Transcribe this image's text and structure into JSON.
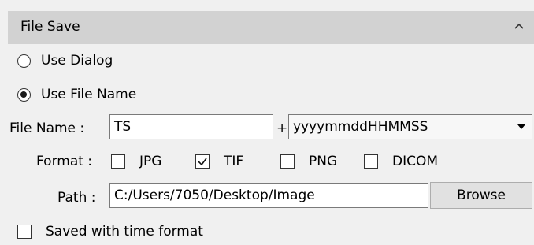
{
  "section": {
    "title": "File Save",
    "collapse_icon": "chevron-up-icon"
  },
  "save_mode": {
    "options": [
      {
        "label": "Use Dialog",
        "checked": false
      },
      {
        "label": "Use File Name",
        "checked": true
      }
    ]
  },
  "file_name": {
    "label": "File Name :",
    "value": "TS",
    "plus": "+",
    "format_selected": "yyyymmddHHMMSS"
  },
  "format": {
    "label": "Format :",
    "options": [
      {
        "label": "JPG",
        "checked": false
      },
      {
        "label": "TIF",
        "checked": true
      },
      {
        "label": "PNG",
        "checked": false
      },
      {
        "label": "DICOM",
        "checked": false
      }
    ]
  },
  "path": {
    "label": "Path :",
    "value": "C:/Users/7050/Desktop/Image",
    "browse_label": "Browse"
  },
  "time_format": {
    "label": "Saved with time format",
    "checked": false
  },
  "colors": {
    "header_bg": "#d2d2d2",
    "panel_bg": "#f0f0f0"
  }
}
